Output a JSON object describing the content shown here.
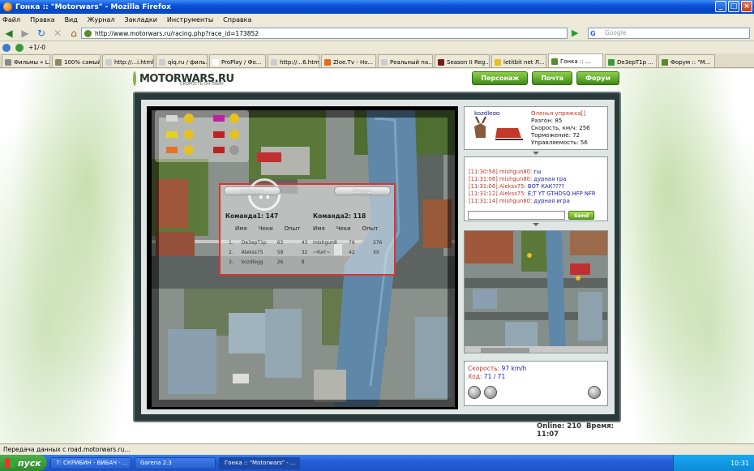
{
  "window": {
    "title": "Гонка :: \"Motorwars\" - Mozilla Firefox"
  },
  "menu": [
    "Файл",
    "Правка",
    "Вид",
    "Журнал",
    "Закладки",
    "Инструменты",
    "Справка"
  ],
  "nav": {
    "url": "http://www.motorwars.ru/racing.php?race_id=173852",
    "search_placeholder": "Google"
  },
  "toolbar2": {
    "counter": "+1/-0"
  },
  "bookmarks": [
    "Фильмы » L...",
    "100% самый...",
    "http://...i.html",
    "qiq.ru / филь...",
    "ProPlay / Фо...",
    "http://...6.html",
    "Zloe.Tv - Ho...",
    "Реальный па...",
    "Season II Reg...",
    "letitbit net Л...",
    "Гонка :: ...",
    "De3epT1p ...",
    "Форум :: \"M..."
  ],
  "site": {
    "logo": "MOTORWARS.RU",
    "logo_sub": "СКОРОСТЬ ОН-ЛАЙН",
    "topnav": [
      "Персонаж",
      "Почта",
      "Форум"
    ],
    "colors": {
      "nav_green": "#4e9a22",
      "red_label": "#c0392b",
      "blue_text": "#1a1aa8"
    }
  },
  "scoreboard": {
    "btn_left": "Рейтинг",
    "btn_right": "Выход",
    "team1": "Команда1:  147",
    "team2": "Команда2:  118",
    "headers": [
      "Имя",
      "Чеки",
      "Опыт"
    ],
    "team1_rows": [
      {
        "n": "1.",
        "name": "De3epT1p",
        "checks": "63",
        "exp": "43"
      },
      {
        "n": "2.",
        "name": "Alekss75",
        "checks": "58",
        "exp": "32"
      },
      {
        "n": "3.",
        "name": "kozdlegg",
        "checks": "26",
        "exp": "8"
      }
    ],
    "team2_rows": [
      {
        "name": "mishgun8",
        "checks": "76",
        "exp": "276"
      },
      {
        "name": "~Кит~",
        "checks": "42",
        "exp": "XII"
      }
    ]
  },
  "player": {
    "name": "kozdlegg",
    "car_title": "Оленья упряжка[]",
    "stats": [
      {
        "label": "Разгон:",
        "value": "85"
      },
      {
        "label": "Скорость, км/ч:",
        "value": "256"
      },
      {
        "label": "Торможение:",
        "value": "72"
      },
      {
        "label": "Управляемость:",
        "value": "56"
      }
    ]
  },
  "chat": {
    "lines": [
      {
        "ts": "[11:30:58]",
        "nick": "mishgun80:",
        "msg": "гы"
      },
      {
        "ts": "[11:31:06]",
        "nick": "mishgun80:",
        "msg": "дурная гра"
      },
      {
        "ts": "[11:31:06]",
        "nick": "Alekss75:",
        "msg": "ВОТ КАК????"
      },
      {
        "ts": "[11:31:12]",
        "nick": "Alekss75:",
        "msg": "E;T YT GTHDSQ HFP NFR"
      },
      {
        "ts": "[11:31:14]",
        "nick": "mishgun80:",
        "msg": "дурная игра"
      }
    ],
    "send_label": "Send"
  },
  "race": {
    "speed_label": "Скорость:",
    "speed_value": "97 km/h",
    "lap_label": "Ход:",
    "lap_value": "71 / 71"
  },
  "status": {
    "online": "Online: 210",
    "time": "Время: 11:07"
  },
  "statusbar": {
    "text": "Передача данных с road.motorwars.ru..."
  },
  "taskbar": {
    "start": "пуск",
    "tasks": [
      "7: СКРИБИН - ВИБАЧ - ...",
      "Garena 2.3",
      "Гонка :: \"Motorwars\" - ..."
    ],
    "clock": "10:31"
  }
}
